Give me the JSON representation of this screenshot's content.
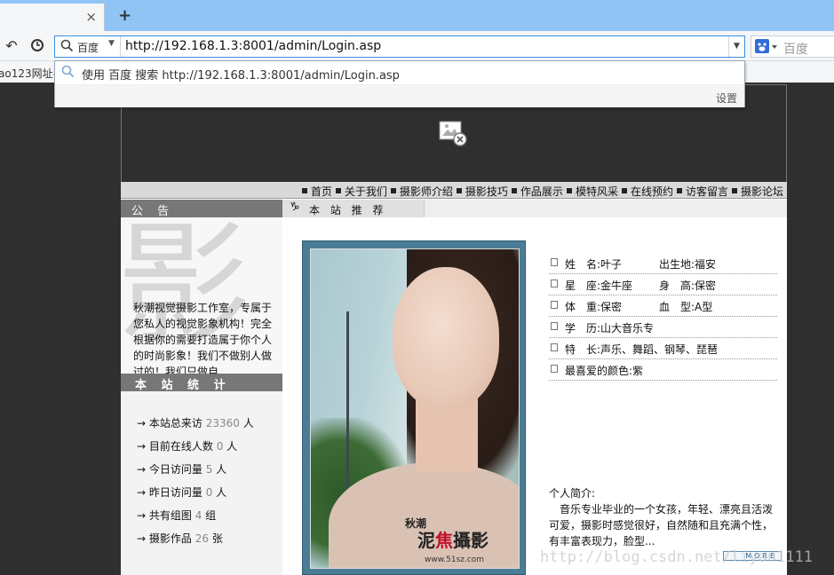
{
  "browser": {
    "tab_close": "×",
    "new_tab": "+",
    "engine_label": "百度",
    "address_url": "http://192.168.1.3:8001/admin/Login.asp",
    "search2_label": "百度",
    "bookmark_text": "ao123网址导",
    "suggestion": "使用 百度 搜索 http://192.168.1.3:8001/admin/Login.asp",
    "settings_label": "设置"
  },
  "site": {
    "menu": [
      "首页",
      "关于我们",
      "摄影师介绍",
      "摄影技巧",
      "作品展示",
      "模特风采",
      "在线预约",
      "访客留言",
      "摄影论坛"
    ],
    "notice_title": "公 告",
    "notice_text": "秋潮视觉摄影工作室，专属于您私人的视觉影象机构！完全根据你的需要打造属于你个人的时尚影象！我们不做别人做过的！我们只做自",
    "notice_bg_glyph": "影",
    "stats_title": "本 站 统 计",
    "stats": [
      {
        "label": "→ 本站总来访",
        "value": "23360",
        "unit": "人"
      },
      {
        "label": "→ 目前在线人数",
        "value": "0",
        "unit": "人"
      },
      {
        "label": "→ 今日访问量",
        "value": "5",
        "unit": "人"
      },
      {
        "label": "→ 昨日访问量",
        "value": "0",
        "unit": "人"
      },
      {
        "label": "→ 共有组图",
        "value": "4",
        "unit": "组"
      },
      {
        "label": "→ 摄影作品",
        "value": "26",
        "unit": "张"
      }
    ],
    "rec_title": "本 站 推 荐",
    "rec_icon": "♑",
    "profile": [
      {
        "left": "姓　名:叶子",
        "right": "出生地:福安"
      },
      {
        "left": "星　座:金牛座",
        "right": "身　高:保密"
      },
      {
        "left": "体　重:保密",
        "right": "血　型:A型"
      },
      {
        "left": "学　历:山大音乐专",
        "right": ""
      },
      {
        "left": "特　长:声乐、舞蹈、钢琴、琵琶",
        "right": ""
      },
      {
        "left": "最喜爱的颜色:紫",
        "right": ""
      }
    ],
    "intro_label": "个人简介:",
    "intro_text": "　音乐专业毕业的一个女孩，年轻、漂亮且活泼可爱，摄影时感觉很好，自然随和且充满个性，有丰富表现力，脸型...",
    "more_label": "MORE",
    "photo_sig_a": "泥",
    "photo_sig_b": "焦",
    "photo_sig_c": "攝影",
    "photo_brand": "秋潮",
    "photo_url": "www.51sz.com"
  },
  "watermark": "http://blog.csdn.net/liyan1111"
}
